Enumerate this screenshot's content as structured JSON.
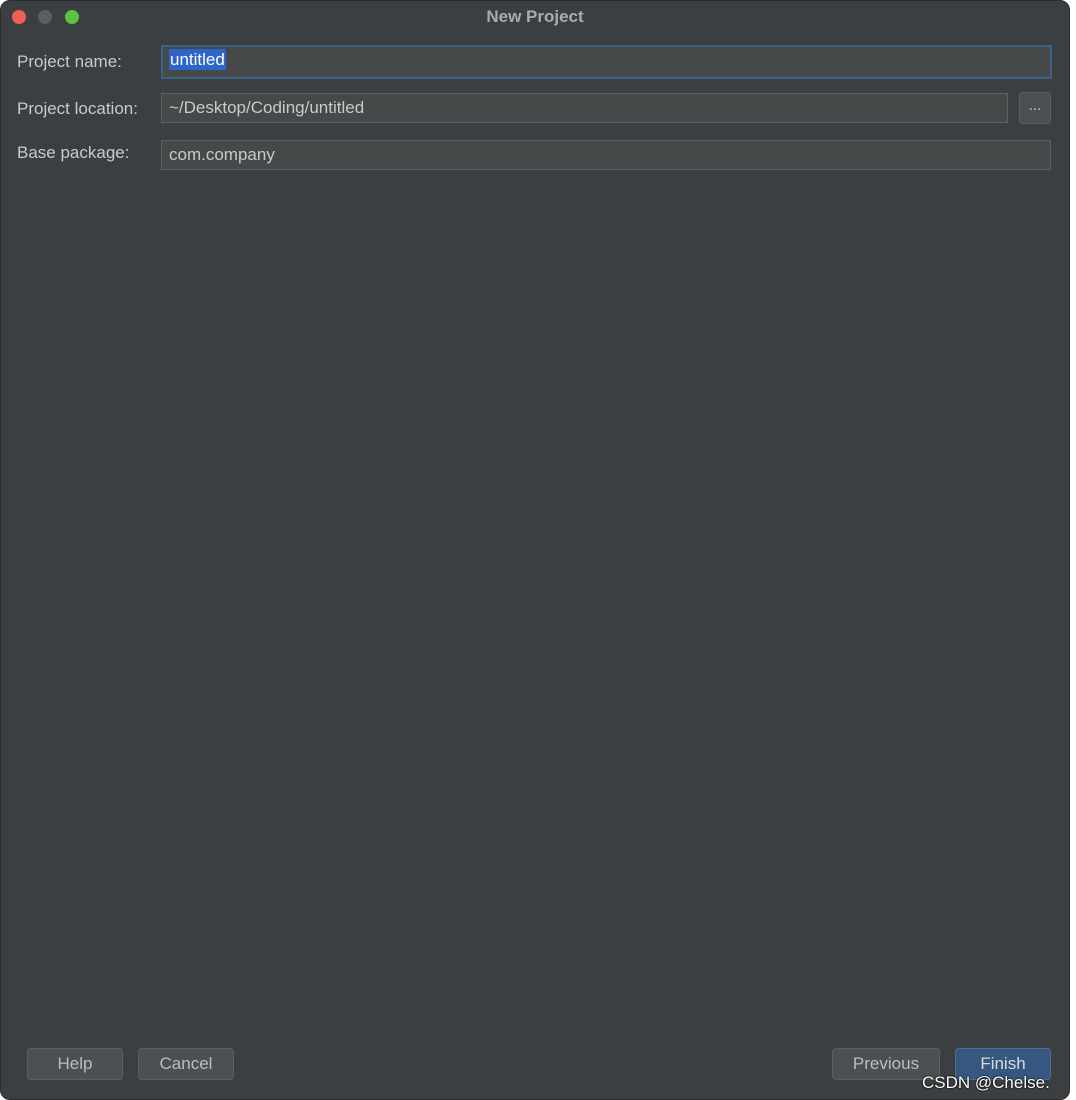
{
  "window": {
    "title": "New Project"
  },
  "traffic_lights": {
    "close_color": "#ee5f57",
    "minimize_color": "#5b5e60",
    "zoom_color": "#5ec343"
  },
  "form": {
    "project_name": {
      "label": "Project name:",
      "value": "untitled"
    },
    "project_location": {
      "label": "Project location:",
      "value": "~/Desktop/Coding/untitled",
      "browse_label": "..."
    },
    "base_package": {
      "label": "Base package:",
      "value": "com.company"
    }
  },
  "footer": {
    "help_label": "Help",
    "cancel_label": "Cancel",
    "previous_label": "Previous",
    "finish_label": "Finish"
  },
  "watermark": {
    "text": "CSDN @Chelse."
  },
  "colors": {
    "dialog_background": "#3c3f41",
    "field_background": "#45494a",
    "focus_border": "#3d6185",
    "selection": "#2f65ca",
    "primary_button": "#365880"
  }
}
